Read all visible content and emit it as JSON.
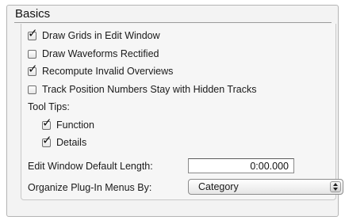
{
  "section": {
    "title": "Basics"
  },
  "options": [
    {
      "label": "Draw Grids in Edit Window",
      "checked": true
    },
    {
      "label": "Draw Waveforms Rectified",
      "checked": false
    },
    {
      "label": "Recompute Invalid Overviews",
      "checked": true
    },
    {
      "label": "Track Position Numbers Stay with Hidden Tracks",
      "checked": false
    }
  ],
  "tooltips": {
    "label": "Tool Tips:",
    "items": [
      {
        "label": "Function",
        "checked": true
      },
      {
        "label": "Details",
        "checked": true
      }
    ]
  },
  "edit_length": {
    "label": "Edit Window Default Length:",
    "value": "0:00.000"
  },
  "plugin_menus": {
    "label": "Organize Plug-In Menus By:",
    "selected": "Category"
  }
}
